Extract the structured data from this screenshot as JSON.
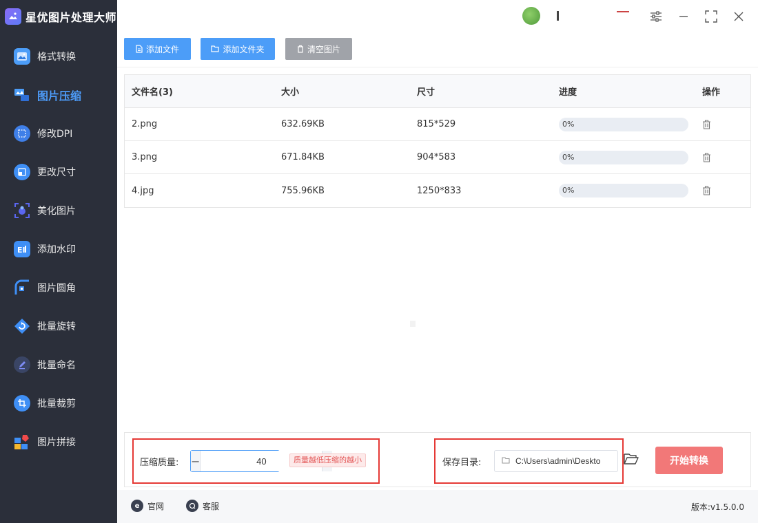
{
  "app": {
    "title": "星优图片处理大师"
  },
  "sidebar": {
    "items": [
      {
        "label": "格式转换",
        "icon": "image-convert-icon",
        "color": "#4c9df8"
      },
      {
        "label": "图片压缩",
        "icon": "image-compress-icon",
        "color": "#4c9df8",
        "active": true
      },
      {
        "label": "修改DPI",
        "icon": "dpi-icon",
        "color": "#3f7fe8"
      },
      {
        "label": "更改尺寸",
        "icon": "resize-icon",
        "color": "#3f8ff5"
      },
      {
        "label": "美化图片",
        "icon": "beautify-icon",
        "color": "#5a66f0"
      },
      {
        "label": "添加水印",
        "icon": "watermark-icon",
        "color": "#3f8ff5"
      },
      {
        "label": "图片圆角",
        "icon": "rounded-corner-icon",
        "color": "#3f8ff5"
      },
      {
        "label": "批量旋转",
        "icon": "rotate-icon",
        "color": "#3f8ff5"
      },
      {
        "label": "批量命名",
        "icon": "rename-icon",
        "color": "#4a5ad8"
      },
      {
        "label": "批量裁剪",
        "icon": "crop-icon",
        "color": "#3f8ff5"
      },
      {
        "label": "图片拼接",
        "icon": "collage-icon",
        "color": "#f04a4a"
      }
    ]
  },
  "toolbar": {
    "add_file": "添加文件",
    "add_folder": "添加文件夹",
    "clear": "清空图片"
  },
  "table": {
    "headers": {
      "name": "文件名(3)",
      "size": "大小",
      "dimensions": "尺寸",
      "progress": "进度",
      "action": "操作"
    },
    "rows": [
      {
        "name": "2.png",
        "size": "632.69KB",
        "dimensions": "815*529",
        "progress_text": "0%",
        "progress": 0
      },
      {
        "name": "3.png",
        "size": "671.84KB",
        "dimensions": "904*583",
        "progress_text": "0%",
        "progress": 0
      },
      {
        "name": "4.jpg",
        "size": "755.96KB",
        "dimensions": "1250*833",
        "progress_text": "0%",
        "progress": 0
      }
    ]
  },
  "settings": {
    "quality_label": "压缩质量:",
    "quality_value": "40",
    "quality_hint": "质量越低压缩的越小",
    "save_label": "保存目录:",
    "save_path": "C:\\Users\\admin\\Deskto",
    "start_button": "开始转换"
  },
  "footer": {
    "website": "官网",
    "support": "客服",
    "version": "版本:v1.5.0.0"
  },
  "colors": {
    "accent": "#4c9df8",
    "start": "#f27878",
    "highlight_box": "#e53935"
  }
}
